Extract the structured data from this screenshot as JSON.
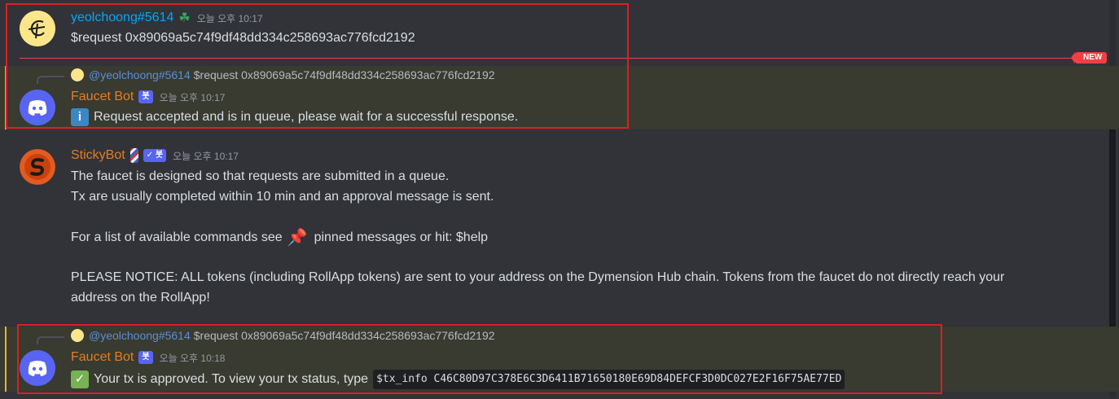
{
  "messages": {
    "m1": {
      "username": "yeolchoong#5614",
      "timestamp": "오늘 오후 10:17",
      "content": "$request 0x89069a5c74f9df48dd334c258693ac776fcd2192",
      "name_color": "#00a8fc"
    },
    "divider": {
      "label": "NEW"
    },
    "m2": {
      "reply_user": "@yeolchoong#5614",
      "reply_text": "$request 0x89069a5c74f9df48dd334c258693ac776fcd2192",
      "username": "Faucet Bot",
      "badge": "봇",
      "timestamp": "오늘 오후 10:17",
      "content": "Request accepted and is in queue, please wait for a successful response.",
      "emoji": "information-emoji",
      "name_color": "#e67e22"
    },
    "m3": {
      "username": "StickyBot",
      "badge": "봇",
      "timestamp": "오늘 오후 10:17",
      "lines": [
        "The faucet is designed so that requests are submitted in a queue.",
        "Tx are usually completed within 10 min and an approval message is sent.",
        "For a list of available commands see",
        "pinned messages or hit: $help",
        "PLEASE NOTICE: ALL tokens (including RollApp tokens) are sent to your address on the Dymension Hub chain. Tokens from the faucet do not directly reach your",
        "address on the RollApp!"
      ],
      "name_color": "#e67e22"
    },
    "m4": {
      "reply_user": "@yeolchoong#5614",
      "reply_text": "$request 0x89069a5c74f9df48dd334c258693ac776fcd2192",
      "username": "Faucet Bot",
      "badge": "봇",
      "timestamp": "오늘 오후 10:18",
      "content": "Your tx is approved. To view your tx status, type",
      "code": "$tx_info C46C80D97C378E6C3D6411B71650180E69D84DEFCF3D0DC027E2F16F75AE77ED",
      "emoji": "check-mark-emoji",
      "name_color": "#e67e22"
    }
  },
  "colors": {
    "background": "#313338",
    "highlight": "#393a30",
    "mention_bar": "#f0b232",
    "annotation": "#e01e1e",
    "new_divider": "#f23f43",
    "badge": "#5865f2"
  }
}
